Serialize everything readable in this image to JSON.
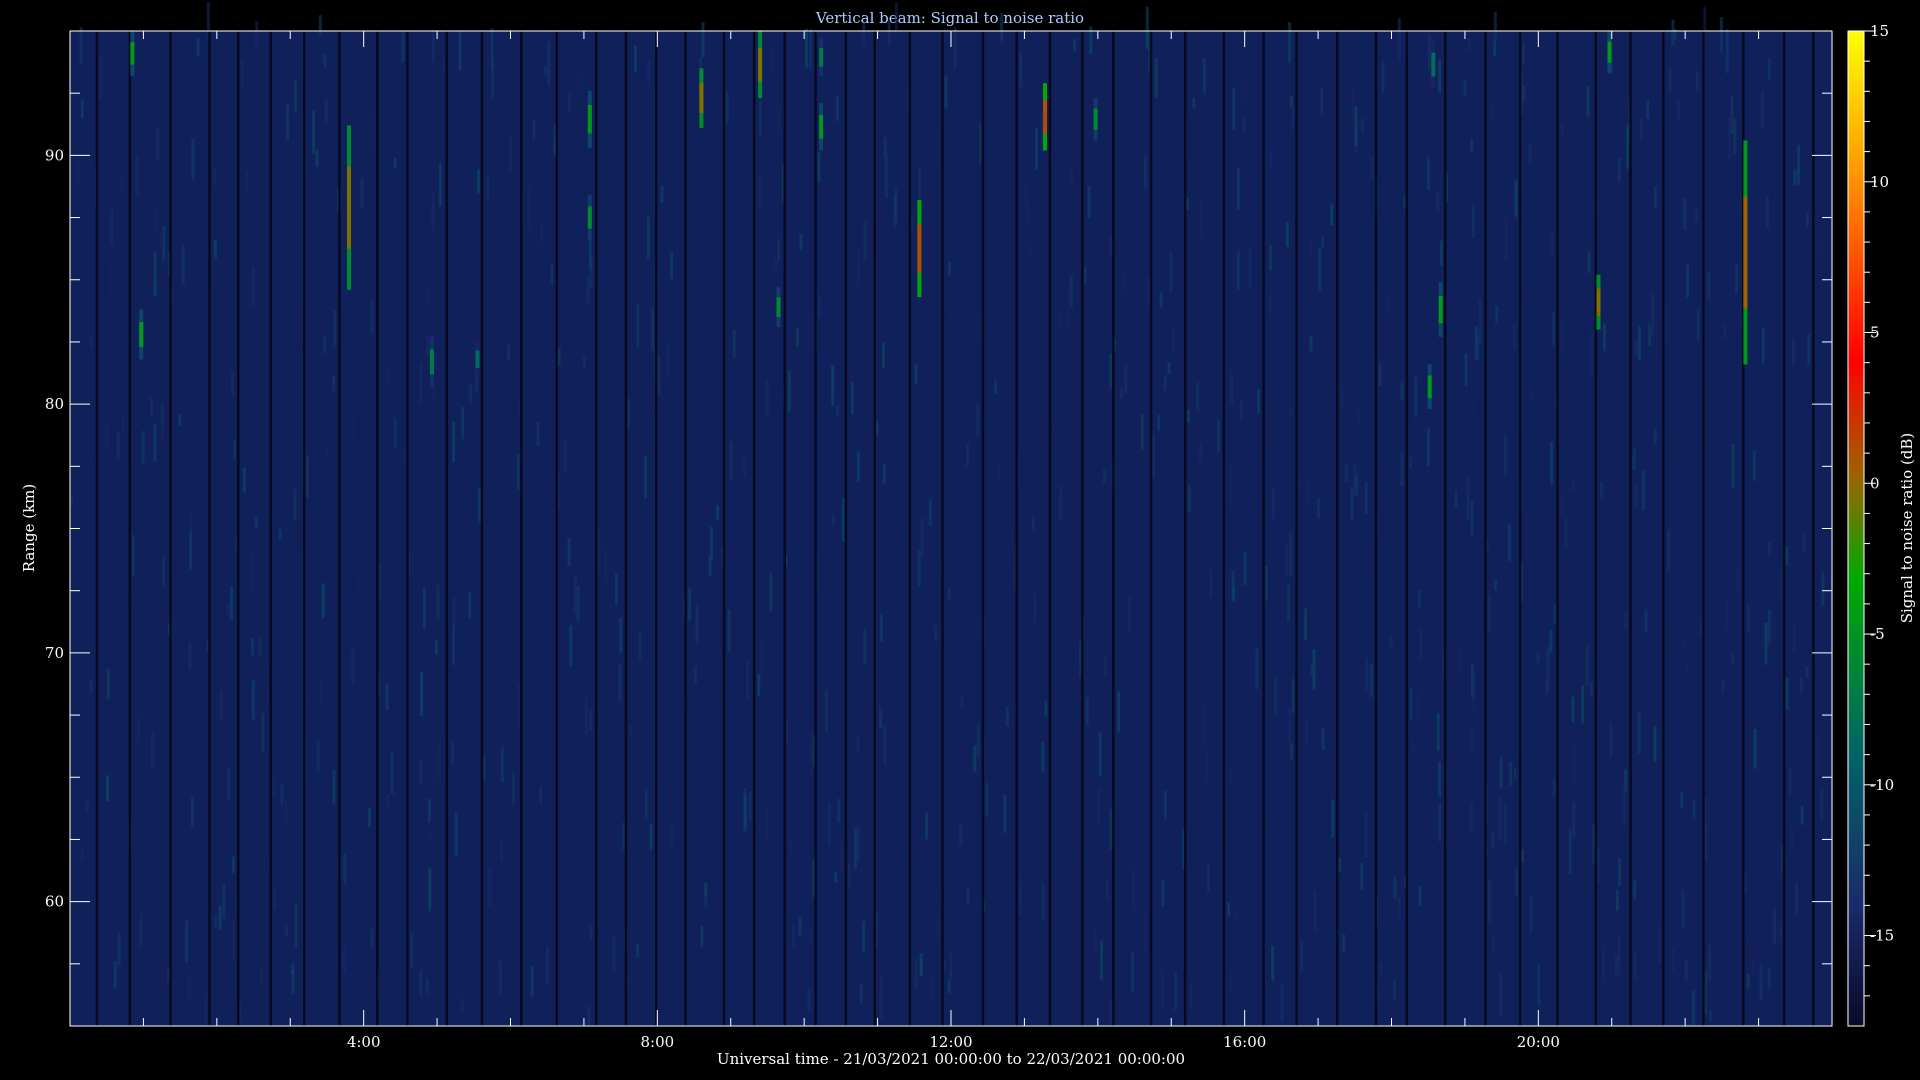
{
  "chart_data": {
    "type": "heatmap",
    "title": "Vertical beam: Signal to noise ratio",
    "xlabel": "Universal time - 21/03/2021 00:00:00 to 22/03/2021 00:00:00",
    "ylabel": "Range (km)",
    "colorbar_label": "Signal to noise ratio (dB)",
    "xlim_hours": [
      0,
      24
    ],
    "ylim_km": [
      55,
      95
    ],
    "x_ticks": [
      {
        "hour": 4,
        "label": "4:00"
      },
      {
        "hour": 8,
        "label": "8:00"
      },
      {
        "hour": 12,
        "label": "12:00"
      },
      {
        "hour": 16,
        "label": "16:00"
      },
      {
        "hour": 20,
        "label": "20:00"
      }
    ],
    "y_ticks": [
      {
        "km": 60,
        "label": "60"
      },
      {
        "km": 70,
        "label": "70"
      },
      {
        "km": 80,
        "label": "80"
      },
      {
        "km": 90,
        "label": "90"
      }
    ],
    "colorbar_range_db": [
      -18,
      15
    ],
    "colorbar_ticks": [
      {
        "db": 15,
        "label": "15"
      },
      {
        "db": 10,
        "label": "10"
      },
      {
        "db": 5,
        "label": "5"
      },
      {
        "db": 0,
        "label": "0"
      },
      {
        "db": -5,
        "label": "-5"
      },
      {
        "db": -10,
        "label": "-10"
      },
      {
        "db": -15,
        "label": "-15"
      }
    ],
    "colormap": [
      "#ffff00",
      "#ff9900",
      "#ff0000",
      "#996600",
      "#00aa00",
      "#006666",
      "#1a2a6a",
      "#0a0a2a"
    ],
    "background_noise_db": -16,
    "echoes": [
      {
        "hour": 0.85,
        "km_low": 93.2,
        "km_high": 95.0,
        "snr_db": -5
      },
      {
        "hour": 0.97,
        "km_low": 81.8,
        "km_high": 83.8,
        "snr_db": -5
      },
      {
        "hour": 3.8,
        "km_low": 84.6,
        "km_high": 91.2,
        "snr_db": 0
      },
      {
        "hour": 4.93,
        "km_low": 80.7,
        "km_high": 82.7,
        "snr_db": -7
      },
      {
        "hour": 5.55,
        "km_low": 81.1,
        "km_high": 82.5,
        "snr_db": -8
      },
      {
        "hour": 7.08,
        "km_low": 90.3,
        "km_high": 92.6,
        "snr_db": -5
      },
      {
        "hour": 7.08,
        "km_low": 86.6,
        "km_high": 88.4,
        "snr_db": -6
      },
      {
        "hour": 8.6,
        "km_low": 91.1,
        "km_high": 93.5,
        "snr_db": 0
      },
      {
        "hour": 9.4,
        "km_low": 92.3,
        "km_high": 95.0,
        "snr_db": 0
      },
      {
        "hour": 9.65,
        "km_low": 83.1,
        "km_high": 84.7,
        "snr_db": -6
      },
      {
        "hour": 10.23,
        "km_low": 90.2,
        "km_high": 92.1,
        "snr_db": -5
      },
      {
        "hour": 10.23,
        "km_low": 93.2,
        "km_high": 94.7,
        "snr_db": -7
      },
      {
        "hour": 11.57,
        "km_low": 84.3,
        "km_high": 88.2,
        "snr_db": 2
      },
      {
        "hour": 13.28,
        "km_low": 90.2,
        "km_high": 92.9,
        "snr_db": 2
      },
      {
        "hour": 13.97,
        "km_low": 90.6,
        "km_high": 92.3,
        "snr_db": -6
      },
      {
        "hour": 18.52,
        "km_low": 79.8,
        "km_high": 81.6,
        "snr_db": -5
      },
      {
        "hour": 18.67,
        "km_low": 82.7,
        "km_high": 84.9,
        "snr_db": -5
      },
      {
        "hour": 18.57,
        "km_low": 92.7,
        "km_high": 94.6,
        "snr_db": -8
      },
      {
        "hour": 20.82,
        "km_low": 83.0,
        "km_high": 85.2,
        "snr_db": 0
      },
      {
        "hour": 20.97,
        "km_low": 93.3,
        "km_high": 95.0,
        "snr_db": -5
      },
      {
        "hour": 22.82,
        "km_low": 81.6,
        "km_high": 90.6,
        "snr_db": 1
      }
    ]
  }
}
